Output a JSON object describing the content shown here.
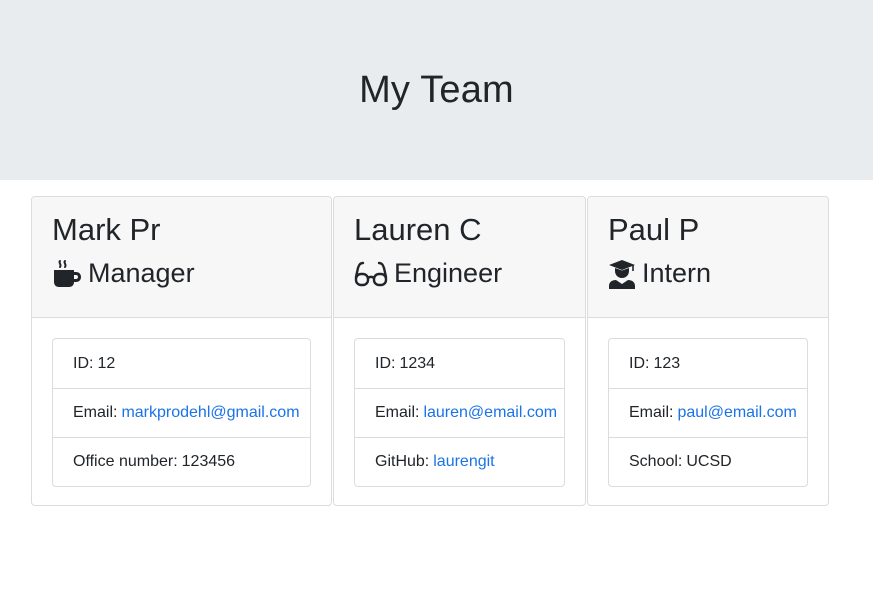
{
  "header": {
    "title": "My Team"
  },
  "employees": [
    {
      "name": "Mark Pr",
      "role": "Manager",
      "icon": "coffee-icon",
      "id_label": "ID:",
      "id": "12",
      "email_label": "Email:",
      "email": "markprodehl@gmail.com",
      "extra_label": "Office number:",
      "extra": "123456"
    },
    {
      "name": "Lauren C",
      "role": "Engineer",
      "icon": "glasses-icon",
      "id_label": "ID:",
      "id": "1234",
      "email_label": "Email:",
      "email": "lauren@email.com",
      "extra_label": "GitHub:",
      "extra": "laurengit"
    },
    {
      "name": "Paul P",
      "role": "Intern",
      "icon": "graduate-icon",
      "id_label": "ID:",
      "id": "123",
      "email_label": "Email:",
      "email": "paul@email.com",
      "extra_label": "School:",
      "extra": "UCSD"
    }
  ],
  "colors": {
    "link": "#1a73e8",
    "jumbotron": "#e9ecef",
    "header_bg": "#f7f7f7"
  }
}
